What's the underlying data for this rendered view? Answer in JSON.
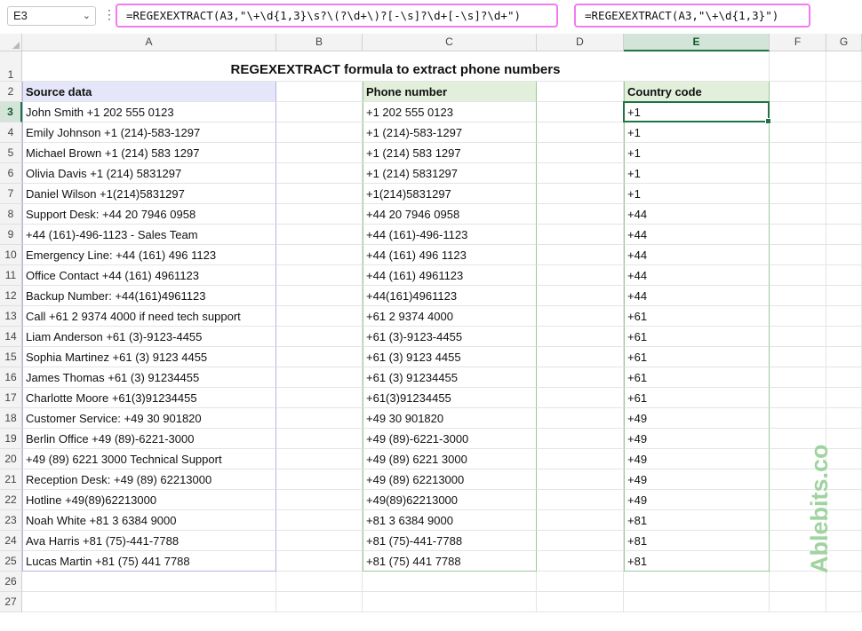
{
  "formula_bar": {
    "name_box": "E3",
    "formula": "=REGEXEXTRACT(A3,\"\\+\\d{1,3}\\s?\\(?\\d+\\)?[-\\s]?\\d+[-\\s]?\\d+\")",
    "callout_formula": "=REGEXEXTRACT(A3,\"\\+\\d{1,3}\")"
  },
  "columns": [
    "A",
    "B",
    "C",
    "D",
    "E",
    "F",
    "G"
  ],
  "active_cell": {
    "col": "E",
    "row": 3
  },
  "sheet": {
    "title": "REGEXEXTRACT formula to extract phone numbers",
    "header_source": "Source data",
    "header_phone": "Phone number",
    "header_country": "Country code",
    "rows": [
      {
        "source": "John Smith +1 202 555 0123",
        "phone": "+1 202 555 0123",
        "code": "+1"
      },
      {
        "source": "Emily Johnson +1 (214)-583-1297",
        "phone": "+1 (214)-583-1297",
        "code": "+1"
      },
      {
        "source": "Michael Brown +1 (214) 583 1297",
        "phone": "+1 (214) 583 1297",
        "code": "+1"
      },
      {
        "source": "Olivia Davis +1 (214) 5831297",
        "phone": "+1 (214) 5831297",
        "code": "+1"
      },
      {
        "source": "Daniel Wilson +1(214)5831297",
        "phone": "+1(214)5831297",
        "code": "+1"
      },
      {
        "source": "Support Desk: +44 20 7946 0958",
        "phone": "+44 20 7946 0958",
        "code": "+44"
      },
      {
        "source": "+44 (161)-496-1123 - Sales Team",
        "phone": "+44 (161)-496-1123",
        "code": "+44"
      },
      {
        "source": "Emergency Line: +44 (161) 496 1123",
        "phone": "+44 (161) 496 1123",
        "code": "+44"
      },
      {
        "source": "Office Contact +44 (161) 4961123",
        "phone": "+44 (161) 4961123",
        "code": "+44"
      },
      {
        "source": "Backup Number: +44(161)4961123",
        "phone": "+44(161)4961123",
        "code": "+44"
      },
      {
        "source": "Call +61 2 9374 4000 if need tech support",
        "phone": "+61 2 9374 4000",
        "code": "+61"
      },
      {
        "source": "Liam Anderson +61 (3)-9123-4455",
        "phone": "+61 (3)-9123-4455",
        "code": "+61"
      },
      {
        "source": "Sophia Martinez +61 (3) 9123 4455",
        "phone": "+61 (3) 9123 4455",
        "code": "+61"
      },
      {
        "source": "James Thomas +61 (3) 91234455",
        "phone": "+61 (3) 91234455",
        "code": "+61"
      },
      {
        "source": "Charlotte Moore +61(3)91234455",
        "phone": "+61(3)91234455",
        "code": "+61"
      },
      {
        "source": "Customer Service: +49 30 901820",
        "phone": "+49 30 901820",
        "code": "+49"
      },
      {
        "source": "Berlin Office +49 (89)-6221-3000",
        "phone": "+49 (89)-6221-3000",
        "code": "+49"
      },
      {
        "source": " +49 (89) 6221 3000 Technical Support",
        "phone": "+49 (89) 6221 3000",
        "code": "+49"
      },
      {
        "source": "Reception Desk: +49 (89) 62213000",
        "phone": "+49 (89) 62213000",
        "code": "+49"
      },
      {
        "source": "Hotline +49(89)62213000",
        "phone": "+49(89)62213000",
        "code": "+49"
      },
      {
        "source": "Noah White +81 3 6384 9000",
        "phone": "+81 3 6384 9000",
        "code": "+81"
      },
      {
        "source": "Ava Harris +81 (75)-441-7788",
        "phone": "+81 (75)-441-7788",
        "code": "+81"
      },
      {
        "source": "Lucas Martin +81 (75) 441 7788",
        "phone": "+81 (75) 441 7788",
        "code": "+81"
      }
    ]
  },
  "watermark": {
    "text": "Ablebits.com",
    "color": "#9fd39f"
  },
  "colors": {
    "accent": "#217346",
    "callout_border": "#f07cf0",
    "source_header_bg": "#e6e6fa",
    "result_header_bg": "#e2efda"
  }
}
